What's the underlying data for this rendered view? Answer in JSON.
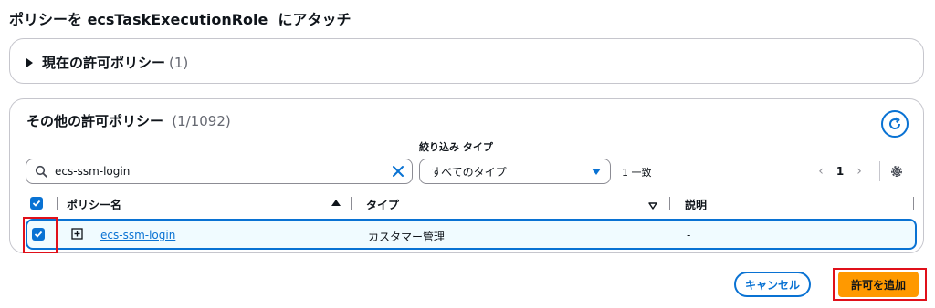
{
  "header": {
    "title": "ポリシーを ecsTaskExecutionRole  にアタッチ"
  },
  "current_policies": {
    "label": "現在の許可ポリシー",
    "count": "(1)"
  },
  "other_policies": {
    "label": "その他の許可ポリシー",
    "count": "(1/1092)",
    "filter_type_label": "絞り込み タイプ",
    "search": {
      "value": "ecs-ssm-login",
      "placeholder": ""
    },
    "type_select": {
      "selected": "すべてのタイプ"
    },
    "match_count": "1 一致",
    "pagination": {
      "current_page": "1",
      "prev": "‹",
      "next": "›"
    },
    "columns": {
      "name": "ポリシー名",
      "type": "タイプ",
      "description": "説明"
    },
    "sort": {
      "name": "ascending",
      "type": "unsorted"
    },
    "rows": [
      {
        "name": "ecs-ssm-login",
        "type": "カスタマー管理",
        "description": "-",
        "selected": true
      }
    ]
  },
  "footer": {
    "cancel_label": "キャンセル",
    "add_label": "許可を追加"
  },
  "colors": {
    "accent": "#0972d3",
    "primary_button": "#ff9900",
    "highlight": "#e0101a"
  }
}
